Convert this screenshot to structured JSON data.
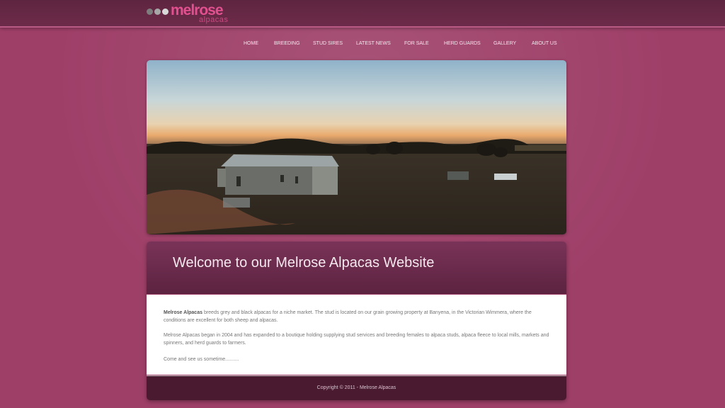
{
  "header": {
    "logo_text": "melrose",
    "logo_sub": "alpacas"
  },
  "nav": {
    "items": [
      "HOME",
      "BREEDING",
      "STUD SIRES",
      "LATEST NEWS",
      "FOR SALE",
      "HERD GUARDS",
      "GALLERY",
      "ABOUT US"
    ]
  },
  "welcome": {
    "title": "Welcome to our Melrose Alpacas Website",
    "p1_bold": "Melrose Alpacas",
    "p1_rest": " breeds grey and black alpacas for a niche market. The stud is located on our grain growing property at Banyena, in the Victorian Wimmera, where the conditions are excellent for both sheep and alpacas.",
    "p2": "Melrose Alpacas began in 2004 and has expanded to a boutique holding supplying stud services and breeding females to alpaca studs, alpaca fleece to local mills, markets and spinners, and herd guards to farmers.",
    "p3": "Come and see us sometime.........."
  },
  "footer": {
    "copyright": "Copyright © 2011 - Melrose Alpacas"
  }
}
